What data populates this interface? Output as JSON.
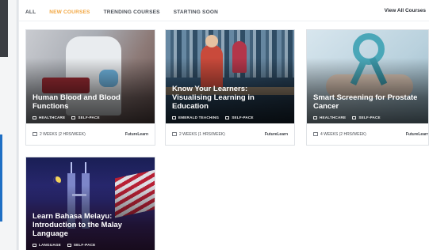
{
  "tabs": [
    {
      "label": "All",
      "active": false
    },
    {
      "label": "New Courses",
      "active": true
    },
    {
      "label": "Trending Courses",
      "active": false
    },
    {
      "label": "Starting Soon",
      "active": false
    }
  ],
  "view_all_label": "View All Courses",
  "colors": {
    "active_tab": "#f2a640",
    "sidebar_accent": "#1f6fc4"
  },
  "cards": [
    {
      "title": "Human Blood and Blood Functions",
      "tags": [
        "HEALTHCARE",
        "SELF-PACE"
      ],
      "duration": "2 WEEKS (2 HRS/WEEK)",
      "provider": "FutureLearn"
    },
    {
      "title": "Know Your Learners: Visualising Learning in Education",
      "tags": [
        "EMERALD TEACHING",
        "SELF-PACE"
      ],
      "duration": "2 WEEKS (1 HRS/WEEK)",
      "provider": "FutureLearn"
    },
    {
      "title": "Smart Screening for Prostate Cancer",
      "tags": [
        "HEALTHCARE",
        "SELF-PACE"
      ],
      "duration": "4 WEEKS (2 HRS/WEEK)",
      "provider": "FutureLearn"
    },
    {
      "title": "Learn Bahasa Melayu: Introduction to the Malay Language",
      "tags": [
        "LANGUAGE",
        "SELF-PACE"
      ]
    }
  ]
}
